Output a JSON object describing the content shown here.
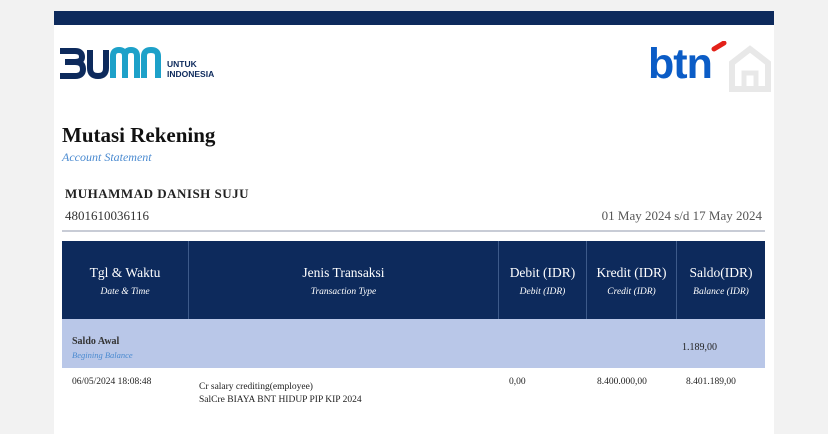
{
  "brand": {
    "bumn_word": "BUMN",
    "bumn_sub_line1": "UNTUK",
    "bumn_sub_line2": "INDONESIA",
    "bank_logo": "btn",
    "colors": {
      "navy": "#0d2a5c",
      "bank_blue": "#0b5cc6",
      "bank_red": "#e32119",
      "light_row": "#b9c7e8",
      "subtitle_blue": "#4a8ad0"
    }
  },
  "statement": {
    "title": "Mutasi Rekening",
    "subtitle": "Account Statement",
    "holder_name": "MUHAMMAD DANISH SUJU",
    "account_number": "4801610036116",
    "period": "01 May 2024 s/d 17 May 2024"
  },
  "table": {
    "columns": [
      {
        "label": "Tgl & Waktu",
        "sublabel": "Date & Time"
      },
      {
        "label": "Jenis Transaksi",
        "sublabel": "Transaction Type"
      },
      {
        "label": "Debit (IDR)",
        "sublabel": "Debit (IDR)"
      },
      {
        "label": "Kredit (IDR)",
        "sublabel": "Credit (IDR)"
      },
      {
        "label": "Saldo(IDR)",
        "sublabel": "Balance (IDR)"
      }
    ],
    "opening": {
      "label": "Saldo Awal",
      "sublabel": "Begining Balance",
      "balance": "1.189,00"
    },
    "rows": [
      {
        "datetime": "06/05/2024 18:08:48",
        "type_line1": "Cr salary crediting(employee)",
        "type_line2": "SalCre BIAYA BNT HIDUP PIP KIP 2024",
        "debit": "0,00",
        "credit": "8.400.000,00",
        "balance": "8.401.189,00"
      }
    ]
  }
}
